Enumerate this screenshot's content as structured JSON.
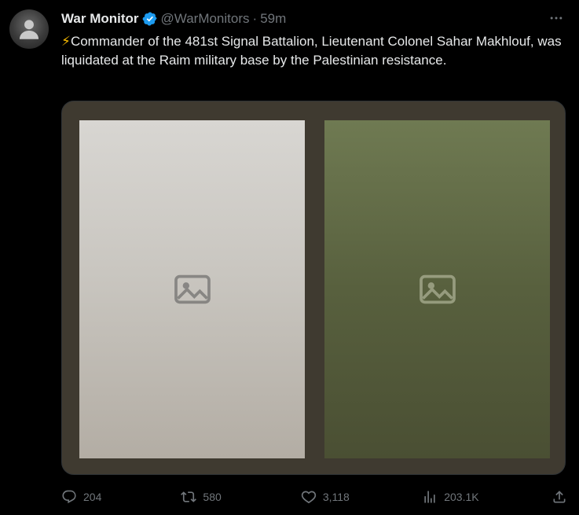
{
  "author": {
    "display_name": "War Monitor",
    "handle": "@WarMonitors",
    "separator": "·",
    "time": "59m",
    "avatar_icon": "profile-avatar-icon",
    "verified_icon": "verified-badge-icon"
  },
  "tweet": {
    "emoji": "⚡",
    "text": "Commander of the 481st Signal Battalion, Lieutenant Colonel Sahar Makhlouf, was liquidated at the Raim military base by the Palestinian resistance."
  },
  "media": {
    "photos": [
      {
        "icon": "image-icon"
      },
      {
        "icon": "image-icon"
      }
    ]
  },
  "actions": {
    "replies": "204",
    "retweets": "580",
    "likes": "3,118",
    "views": "203.1K"
  },
  "colors": {
    "background": "#000000",
    "text_primary": "#e7e9ea",
    "text_secondary": "#71767b",
    "verified_blue": "#1d9bf0",
    "emoji_yellow": "#f5b800",
    "media_frame": "#3f3a30"
  }
}
